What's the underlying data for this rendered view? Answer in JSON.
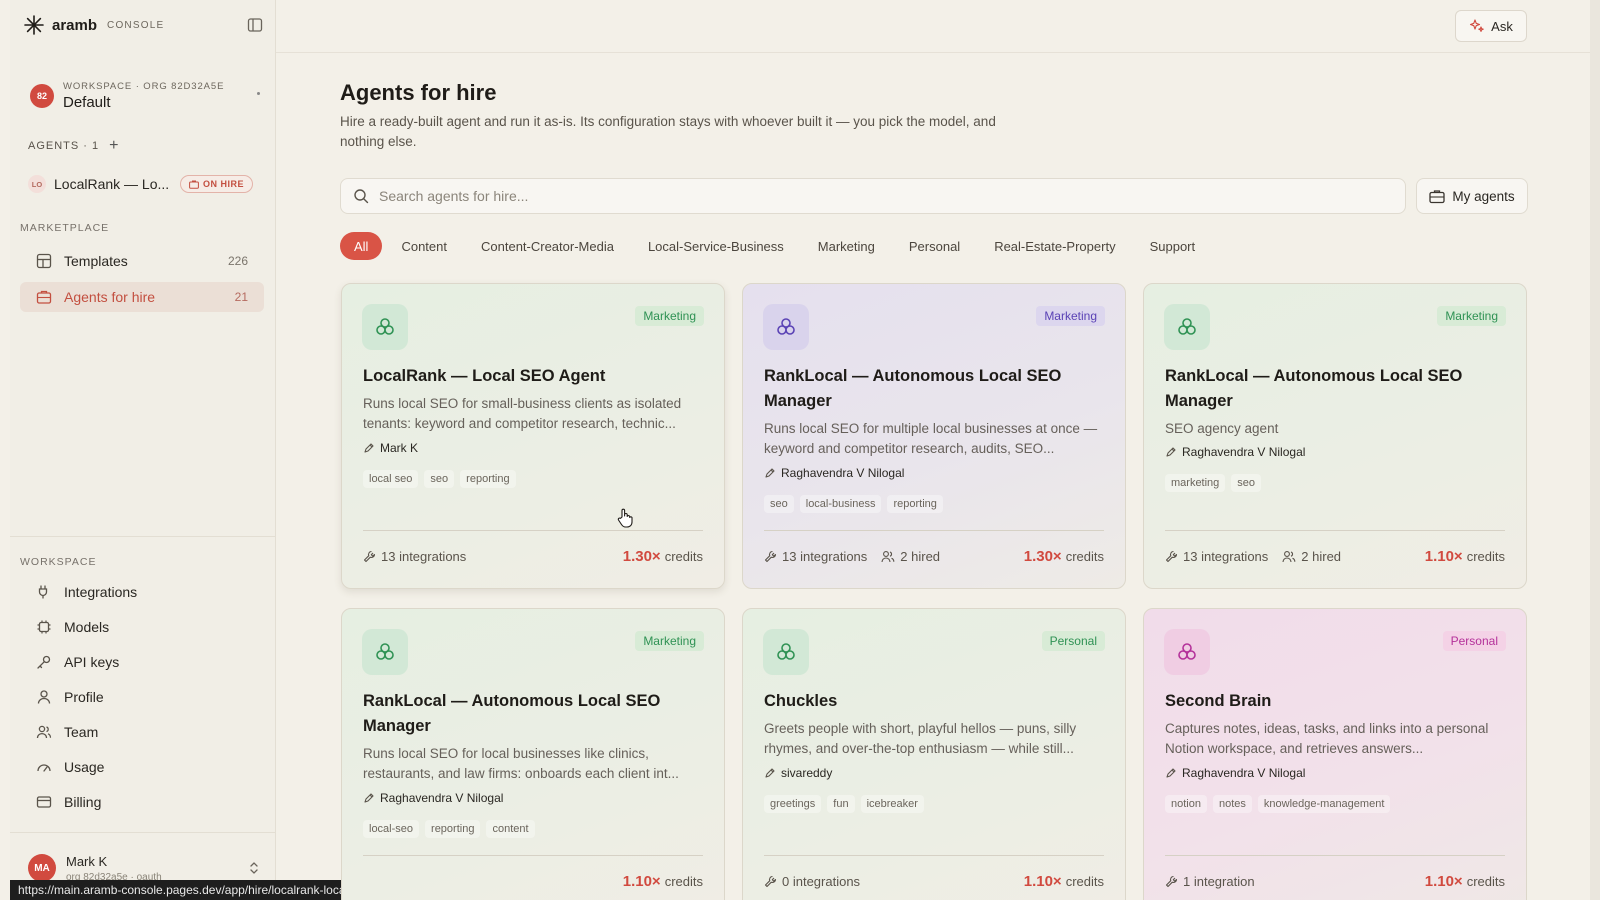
{
  "brand": {
    "name": "aramb",
    "sub": "CONSOLE"
  },
  "workspace": {
    "avatar": "82",
    "meta": "WORKSPACE · ORG 82D32A5E",
    "name": "Default"
  },
  "agents_section": {
    "label": "AGENTS · 1",
    "add_icon": "plus-icon"
  },
  "current_agent": {
    "avatar": "LO",
    "name": "LocalRank — Lo...",
    "badge": "ON HIRE"
  },
  "marketplace": {
    "label": "MARKETPLACE",
    "items": [
      {
        "label": "Templates",
        "count": "226",
        "icon": "grid-icon"
      },
      {
        "label": "Agents for hire",
        "count": "21",
        "icon": "briefcase-icon",
        "active": true
      }
    ]
  },
  "workspace_nav": {
    "label": "WORKSPACE",
    "items": [
      {
        "label": "Integrations",
        "icon": "plug-icon"
      },
      {
        "label": "Models",
        "icon": "chip-icon"
      },
      {
        "label": "API keys",
        "icon": "key-icon"
      },
      {
        "label": "Profile",
        "icon": "user-icon"
      },
      {
        "label": "Team",
        "icon": "team-icon"
      },
      {
        "label": "Usage",
        "icon": "gauge-icon"
      },
      {
        "label": "Billing",
        "icon": "card-icon"
      }
    ]
  },
  "user": {
    "avatar": "MA",
    "name": "Mark K",
    "meta": "org 82d32a5e · oauth"
  },
  "status_url": "https://main.aramb-console.pages.dev/app/hire/localrank-local-seo-agent-1ed0a",
  "header": {
    "ask_label": "Ask"
  },
  "page": {
    "title": "Agents for hire",
    "description": "Hire a ready-built agent and run it as-is. Its configuration stays with whoever built it — you pick the model, and nothing else."
  },
  "search": {
    "placeholder": "Search agents for hire...",
    "my_agents_label": "My agents"
  },
  "filters": [
    "All",
    "Content",
    "Content-Creator-Media",
    "Local-Service-Business",
    "Marketing",
    "Personal",
    "Real-Estate-Property",
    "Support"
  ],
  "colors": {
    "accent": "#d95446",
    "green_badge": "#2f9254",
    "purple_badge": "#5a42b5",
    "pink_badge": "#b4319a"
  },
  "cards": [
    {
      "theme": "green",
      "category": "Marketing",
      "title": "LocalRank — Local SEO Agent",
      "description": "Runs local SEO for small-business clients as isolated tenants: keyword and competitor research, technic...",
      "author": "Mark K",
      "tags": [
        "local seo",
        "seo",
        "reporting"
      ],
      "integrations": "13 integrations",
      "hired": "",
      "multiplier": "1.30×",
      "credits_word": "credits"
    },
    {
      "theme": "purple",
      "category": "Marketing",
      "title": "RankLocal — Autonomous Local SEO Manager",
      "description": "Runs local SEO for multiple local businesses at once —keyword and competitor research, audits, SEO...",
      "author": "Raghavendra V Nilogal",
      "tags": [
        "seo",
        "local-business",
        "reporting"
      ],
      "integrations": "13 integrations",
      "hired": "2 hired",
      "multiplier": "1.30×",
      "credits_word": "credits"
    },
    {
      "theme": "green",
      "category": "Marketing",
      "title": "RankLocal — Autonomous Local SEO Manager",
      "description": "SEO agency agent",
      "author": "Raghavendra V Nilogal",
      "tags": [
        "marketing",
        "seo"
      ],
      "integrations": "13 integrations",
      "hired": "2 hired",
      "multiplier": "1.10×",
      "credits_word": "credits"
    },
    {
      "theme": "green",
      "category": "Marketing",
      "title": "RankLocal — Autonomous Local SEO Manager",
      "description": "Runs local SEO for local businesses like clinics, restaurants, and law firms: onboards each client int...",
      "author": "Raghavendra V Nilogal",
      "tags": [
        "local-seo",
        "reporting",
        "content"
      ],
      "integrations": "",
      "hired": "",
      "multiplier": "1.10×",
      "credits_word": "credits"
    },
    {
      "theme": "green",
      "category": "Personal",
      "title": "Chuckles",
      "description": "Greets people with short, playful hellos — puns, silly rhymes, and over-the-top enthusiasm — while still...",
      "author": "sivareddy",
      "tags": [
        "greetings",
        "fun",
        "icebreaker"
      ],
      "integrations": "0 integrations",
      "hired": "",
      "multiplier": "1.10×",
      "credits_word": "credits"
    },
    {
      "theme": "pink",
      "category": "Personal",
      "title": "Second Brain",
      "description": "Captures notes, ideas, tasks, and links into a personal Notion workspace, and retrieves answers...",
      "author": "Raghavendra V Nilogal",
      "tags": [
        "notion",
        "notes",
        "knowledge-management"
      ],
      "integrations": "1 integration",
      "hired": "",
      "multiplier": "1.10×",
      "credits_word": "credits"
    }
  ]
}
